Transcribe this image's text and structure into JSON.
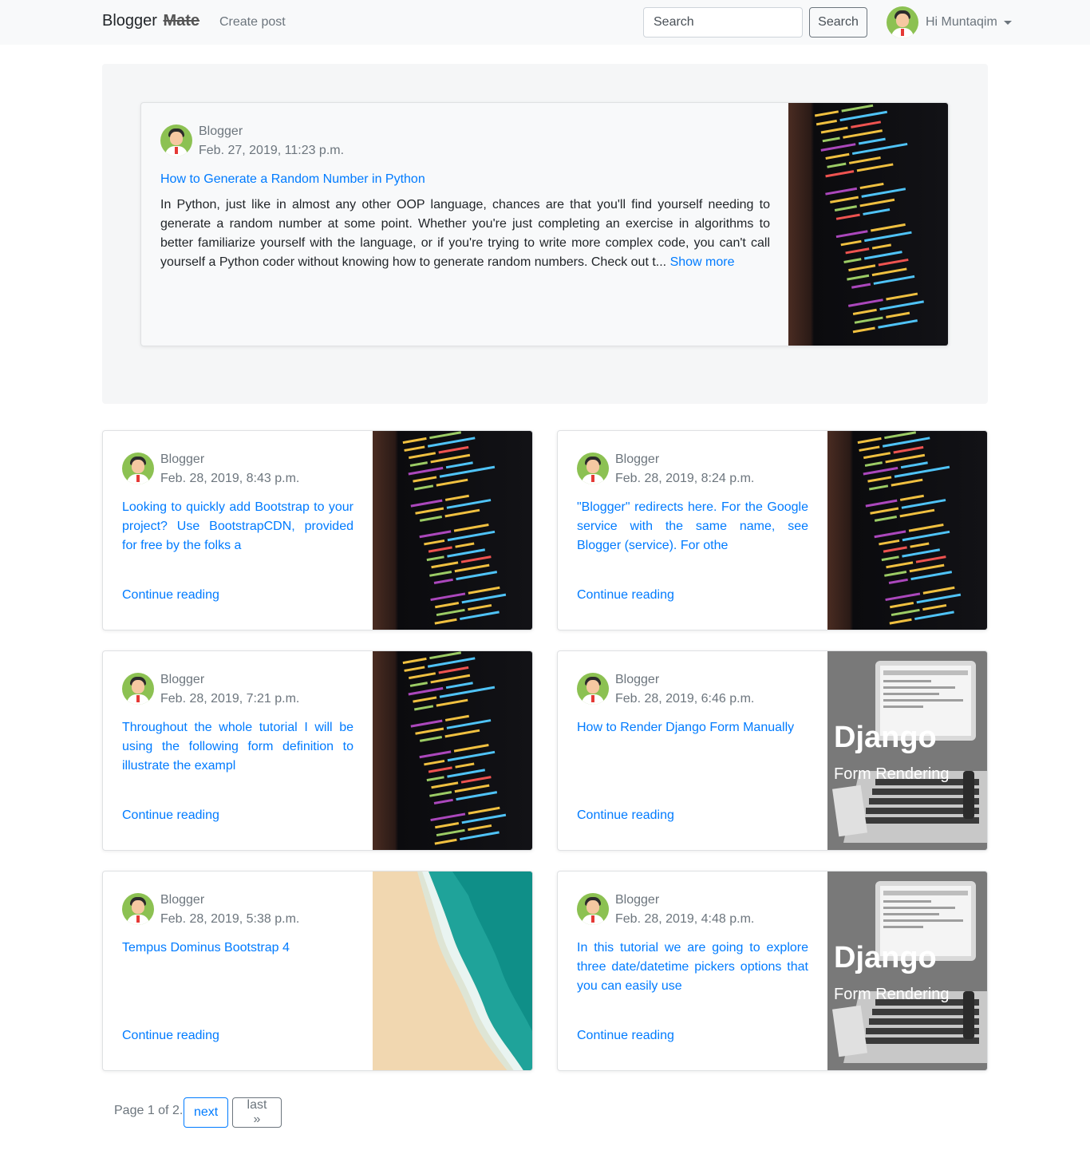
{
  "navbar": {
    "brand": "Blogger",
    "brand_suffix": "Mate",
    "create_post": "Create post",
    "search_placeholder": "Search",
    "search_button": "Search",
    "user_greeting": "Hi Muntaqim"
  },
  "featured": {
    "author": "Blogger",
    "date": "Feb. 27, 2019, 11:23 p.m.",
    "title": "How to Generate a Random Number in Python",
    "excerpt": "In Python, just like in almost any other OOP language, chances are that you'll find yourself needing to generate a random number at some point. Whether you're just completing an exercise in algorithms to better familiarize yourself with the language, or if you're trying to write more complex code, you can't call yourself a Python coder without knowing how to generate random numbers. Check out t...",
    "show_more": "Show more",
    "image": "code-screen"
  },
  "posts": [
    {
      "author": "Blogger",
      "date": "Feb. 28, 2019, 8:43 p.m.",
      "title": "Looking to quickly add Bootstrap to your project? Use BootstrapCDN, provided for free by the folks a",
      "read": "Continue reading",
      "image": "code-screen"
    },
    {
      "author": "Blogger",
      "date": "Feb. 28, 2019, 8:24 p.m.",
      "title": "\"Blogger\" redirects here. For the Google service with the same name, see Blogger (service). For othe",
      "read": "Continue reading",
      "image": "code-screen"
    },
    {
      "author": "Blogger",
      "date": "Feb. 28, 2019, 7:21 p.m.",
      "title": "Throughout the whole tutorial I will be using the following form definition to illustrate the exampl",
      "read": "Continue reading",
      "image": "code-screen"
    },
    {
      "author": "Blogger",
      "date": "Feb. 28, 2019, 6:46 p.m.",
      "title": "How to Render Django Form Manually",
      "read": "Continue reading",
      "image": "django-laptop",
      "image_text_1": "Django",
      "image_text_2": "Form Rendering"
    },
    {
      "author": "Blogger",
      "date": "Feb. 28, 2019, 5:38 p.m.",
      "title": "Tempus Dominus Bootstrap 4",
      "read": "Continue reading",
      "image": "beach-aerial"
    },
    {
      "author": "Blogger",
      "date": "Feb. 28, 2019, 4:48 p.m.",
      "title": "In this tutorial we are going to explore three date/datetime pickers options that you can easily use",
      "read": "Continue reading",
      "image": "django-laptop",
      "image_text_1": "Django",
      "image_text_2": "Form Rendering"
    }
  ],
  "pagination": {
    "status": "Page 1 of 2.",
    "next": "next",
    "last": "last »"
  },
  "colors": {
    "link": "#007bff",
    "muted": "#6c757d",
    "navbar_bg": "#f8f9fa"
  }
}
